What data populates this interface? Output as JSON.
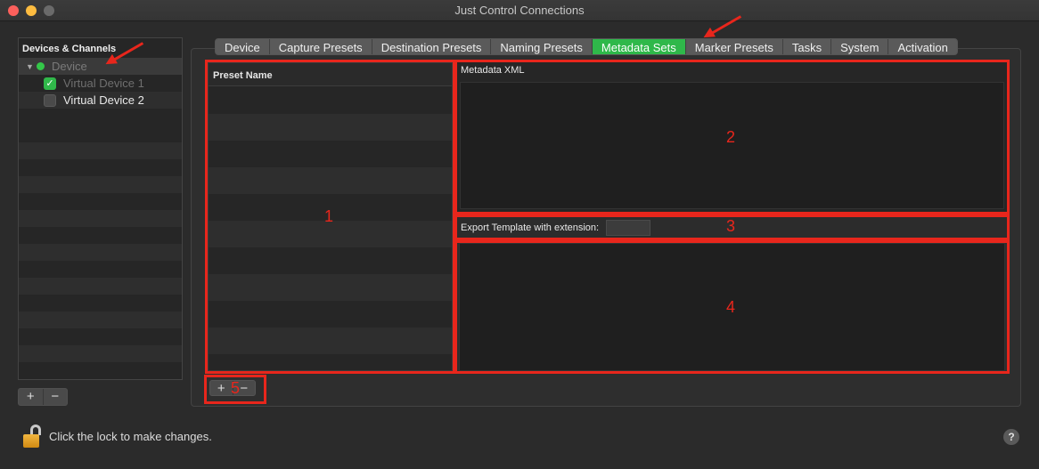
{
  "window": {
    "title": "Just Control Connections"
  },
  "sidebar": {
    "header": "Devices & Channels",
    "device": {
      "label": "Device",
      "status_color": "#34c749"
    },
    "channels": [
      {
        "label": "Virtual Device 1",
        "checked": true
      },
      {
        "label": "Virtual Device 2",
        "checked": false
      }
    ],
    "add_label": "+",
    "remove_label": "−"
  },
  "tabs": [
    {
      "label": "Device"
    },
    {
      "label": "Capture Presets"
    },
    {
      "label": "Destination Presets"
    },
    {
      "label": "Naming Presets"
    },
    {
      "label": "Metadata Sets",
      "active": true
    },
    {
      "label": "Marker Presets"
    },
    {
      "label": "Tasks"
    },
    {
      "label": "System"
    },
    {
      "label": "Activation"
    }
  ],
  "preset_list": {
    "column_header": "Preset Name",
    "add_label": "+",
    "remove_label": "−"
  },
  "metadata": {
    "xml_label": "Metadata XML",
    "export_label": "Export Template with extension:",
    "extension_value": ""
  },
  "annotations": [
    "1",
    "2",
    "3",
    "4",
    "5"
  ],
  "footer": {
    "lock_text": "Click the lock to make changes.",
    "help_label": "?"
  },
  "colors": {
    "accent_green": "#2fb84a",
    "annotation_red": "#e8261c"
  }
}
